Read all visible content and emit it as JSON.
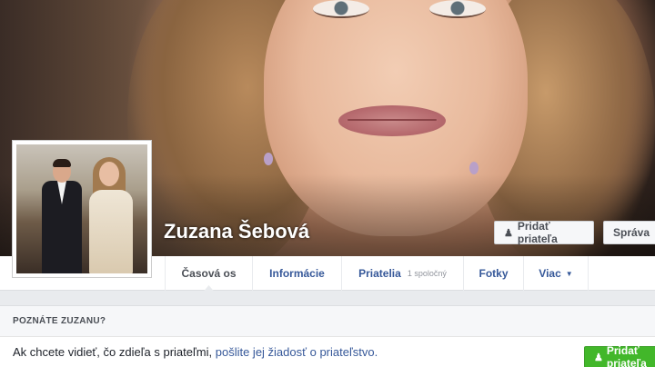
{
  "profile": {
    "name": "Zuzana Šebová"
  },
  "cover_buttons": {
    "add_friend": "Pridať priateľa",
    "message": "Správa",
    "add_friend_icon": "person-plus-icon"
  },
  "tabs": [
    {
      "label": "Časová os",
      "active": true
    },
    {
      "label": "Informácie"
    },
    {
      "label": "Priatelia",
      "sub": "1 spoločný"
    },
    {
      "label": "Fotky"
    },
    {
      "label": "Viac"
    }
  ],
  "info_box": {
    "header": "POZNÁTE ZUZANU?",
    "body_text": "Ak chcete vidieť, čo zdieľa s priateľmi,",
    "body_link": "pošlite jej žiadosť o priateľstvo.",
    "add_friend_button": "Pridať priateľa"
  },
  "colors": {
    "link": "#365899",
    "green_button": "#42b72a",
    "page_background": "#e9ebee"
  }
}
